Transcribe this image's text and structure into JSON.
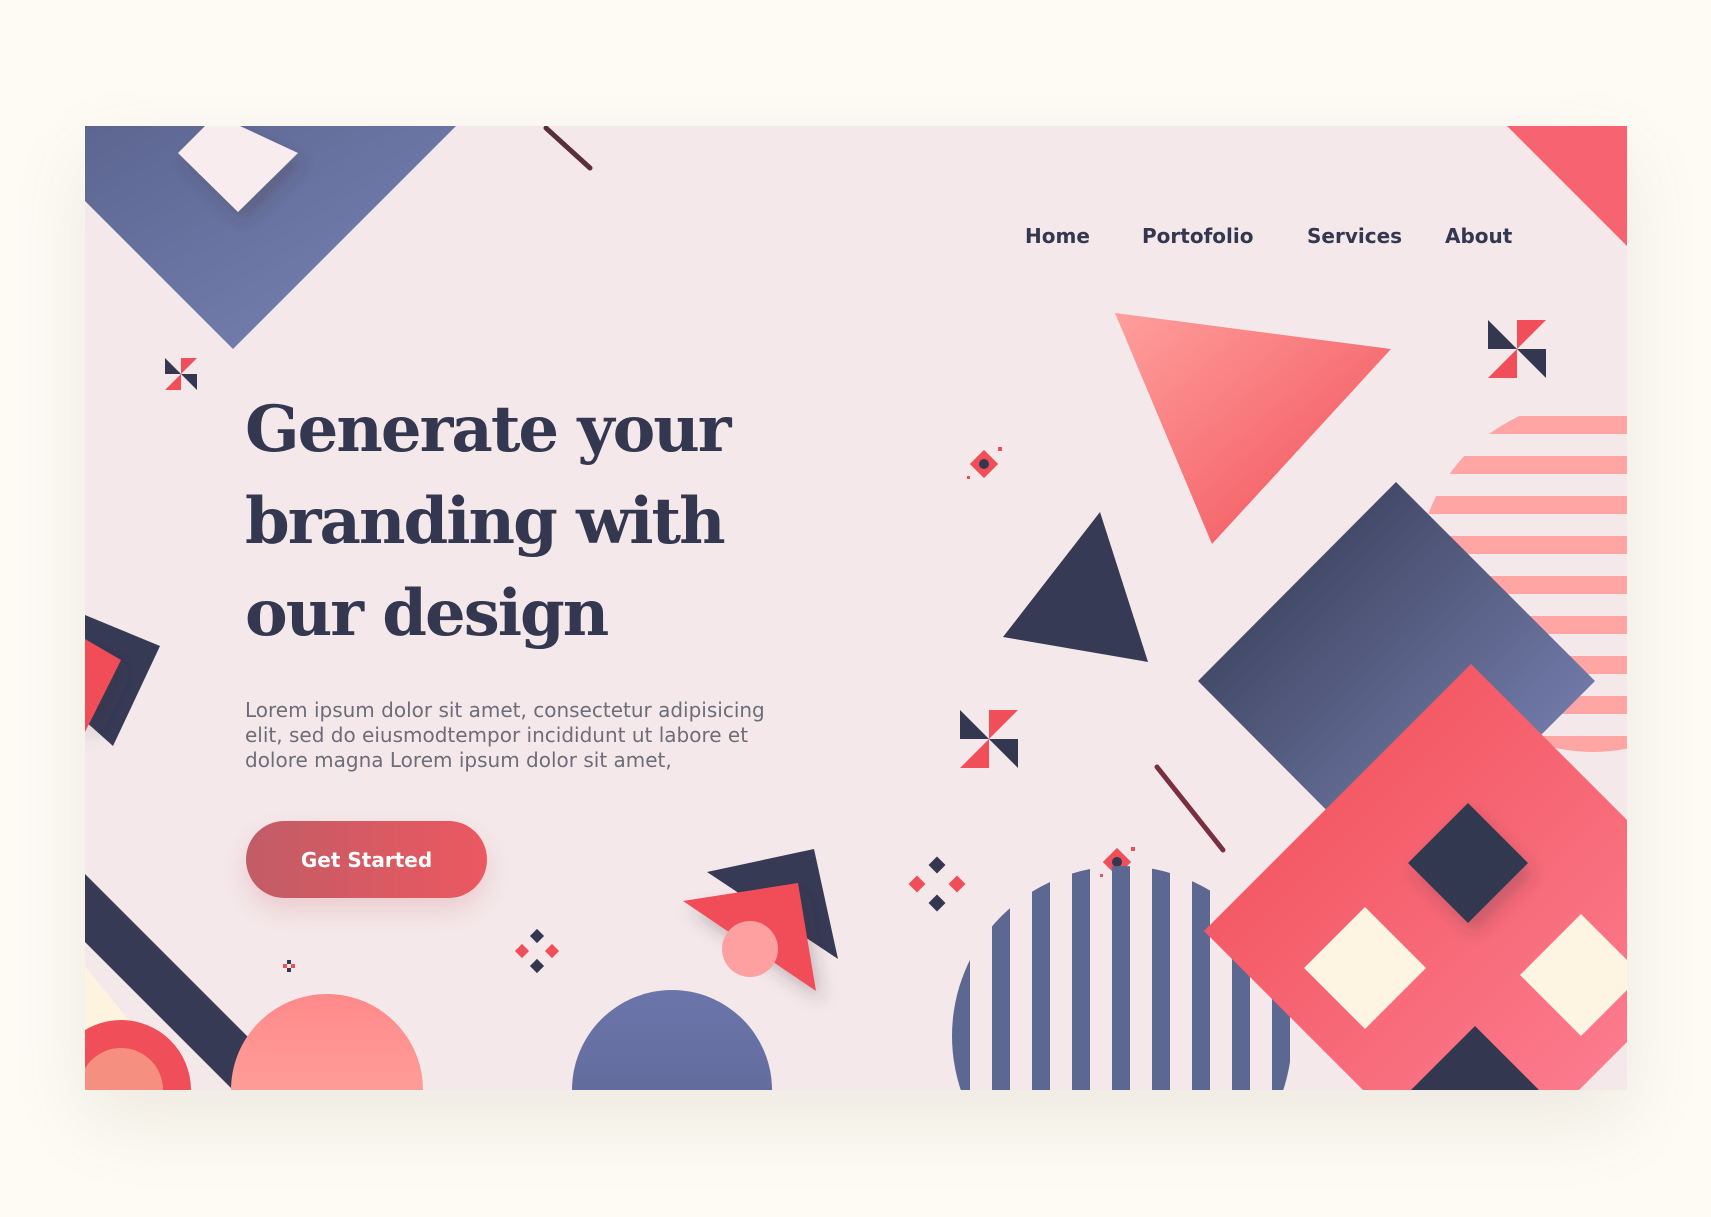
{
  "nav": {
    "items": [
      {
        "label": "Home"
      },
      {
        "label": "Portofolio"
      },
      {
        "label": "Services"
      },
      {
        "label": "About"
      }
    ]
  },
  "hero": {
    "title_lines": [
      "Generate your",
      "branding with",
      "our design"
    ],
    "description": "Lorem ipsum dolor sit amet, consectetur adipisicing elit, sed do eiusmodtempor incididunt ut labore et dolore magna Lorem ipsum dolor sit amet,",
    "cta_label": "Get Started"
  },
  "colors": {
    "background": "#f4e8ea",
    "outer": "#fdfbf4",
    "navy": "#33374f",
    "indigo": "#6f7aae",
    "coral": "#f0525c",
    "pink": "#ff9a9a",
    "cream": "#fdf7e6"
  }
}
